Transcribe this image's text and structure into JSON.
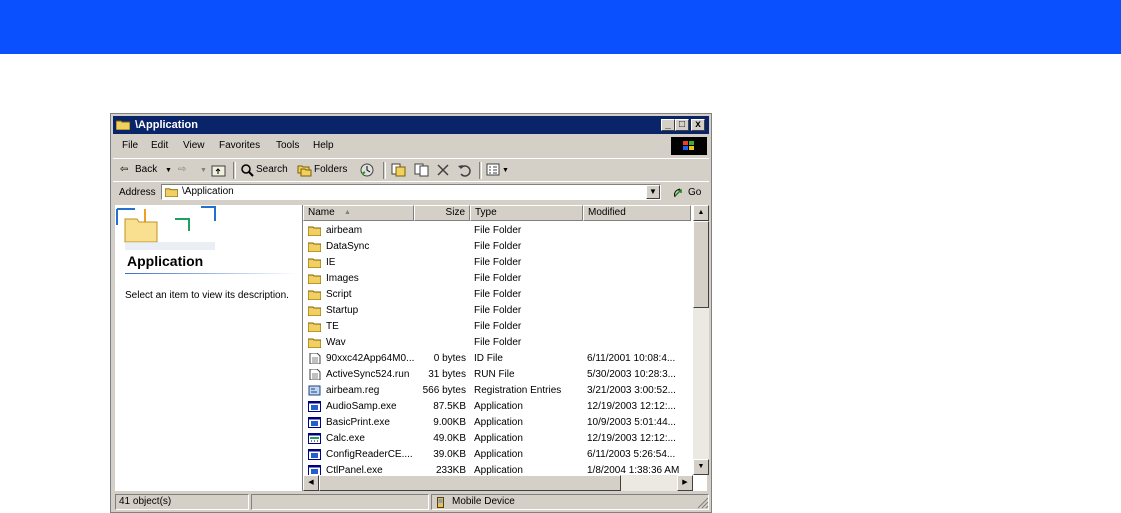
{
  "window": {
    "title": "\\Application",
    "buttons": {
      "minimize": "_",
      "maximize": "□",
      "close": "x"
    }
  },
  "menu": [
    "File",
    "Edit",
    "View",
    "Favorites",
    "Tools",
    "Help"
  ],
  "toolbar": {
    "back": "Back",
    "search": "Search",
    "folders": "Folders"
  },
  "address": {
    "label": "Address",
    "value": "\\Application",
    "go": "Go"
  },
  "left_pane": {
    "title": "Application",
    "description": "Select an item to view its description."
  },
  "columns": {
    "name": "Name",
    "size": "Size",
    "type": "Type",
    "modified": "Modified"
  },
  "files": [
    {
      "name": "airbeam",
      "size": "",
      "type": "File Folder",
      "modified": "",
      "icon": "folder-icon"
    },
    {
      "name": "DataSync",
      "size": "",
      "type": "File Folder",
      "modified": "",
      "icon": "folder-icon"
    },
    {
      "name": "IE",
      "size": "",
      "type": "File Folder",
      "modified": "",
      "icon": "folder-icon"
    },
    {
      "name": "Images",
      "size": "",
      "type": "File Folder",
      "modified": "",
      "icon": "folder-icon"
    },
    {
      "name": "Script",
      "size": "",
      "type": "File Folder",
      "modified": "",
      "icon": "folder-icon"
    },
    {
      "name": "Startup",
      "size": "",
      "type": "File Folder",
      "modified": "",
      "icon": "folder-icon"
    },
    {
      "name": "TE",
      "size": "",
      "type": "File Folder",
      "modified": "",
      "icon": "folder-icon"
    },
    {
      "name": "Wav",
      "size": "",
      "type": "File Folder",
      "modified": "",
      "icon": "folder-icon"
    },
    {
      "name": "90xxc42App64M0...",
      "size": "0 bytes",
      "type": "ID File",
      "modified": "6/11/2001 10:08:4...",
      "icon": "document-icon"
    },
    {
      "name": "ActiveSync524.run",
      "size": "31 bytes",
      "type": "RUN File",
      "modified": "5/30/2003 10:28:3...",
      "icon": "document-icon"
    },
    {
      "name": "airbeam.reg",
      "size": "566 bytes",
      "type": "Registration Entries",
      "modified": "3/21/2003 3:00:52...",
      "icon": "registry-icon"
    },
    {
      "name": "AudioSamp.exe",
      "size": "87.5KB",
      "type": "Application",
      "modified": "12/19/2003 12:12:...",
      "icon": "application-icon"
    },
    {
      "name": "BasicPrint.exe",
      "size": "9.00KB",
      "type": "Application",
      "modified": "10/9/2003 5:01:44...",
      "icon": "application-icon"
    },
    {
      "name": "Calc.exe",
      "size": "49.0KB",
      "type": "Application",
      "modified": "12/19/2003 12:12:...",
      "icon": "calculator-icon"
    },
    {
      "name": "ConfigReaderCE....",
      "size": "39.0KB",
      "type": "Application",
      "modified": "6/11/2003 5:26:54...",
      "icon": "application-icon"
    },
    {
      "name": "CtlPanel.exe",
      "size": "233KB",
      "type": "Application",
      "modified": "1/8/2004 1:38:36 AM",
      "icon": "application-icon"
    }
  ],
  "status": {
    "objects": "41 object(s)",
    "zone": "Mobile Device"
  },
  "colors": {
    "banner": "#0a50ff",
    "titlebar": "#0a246a",
    "chrome": "#d4d0c8"
  }
}
